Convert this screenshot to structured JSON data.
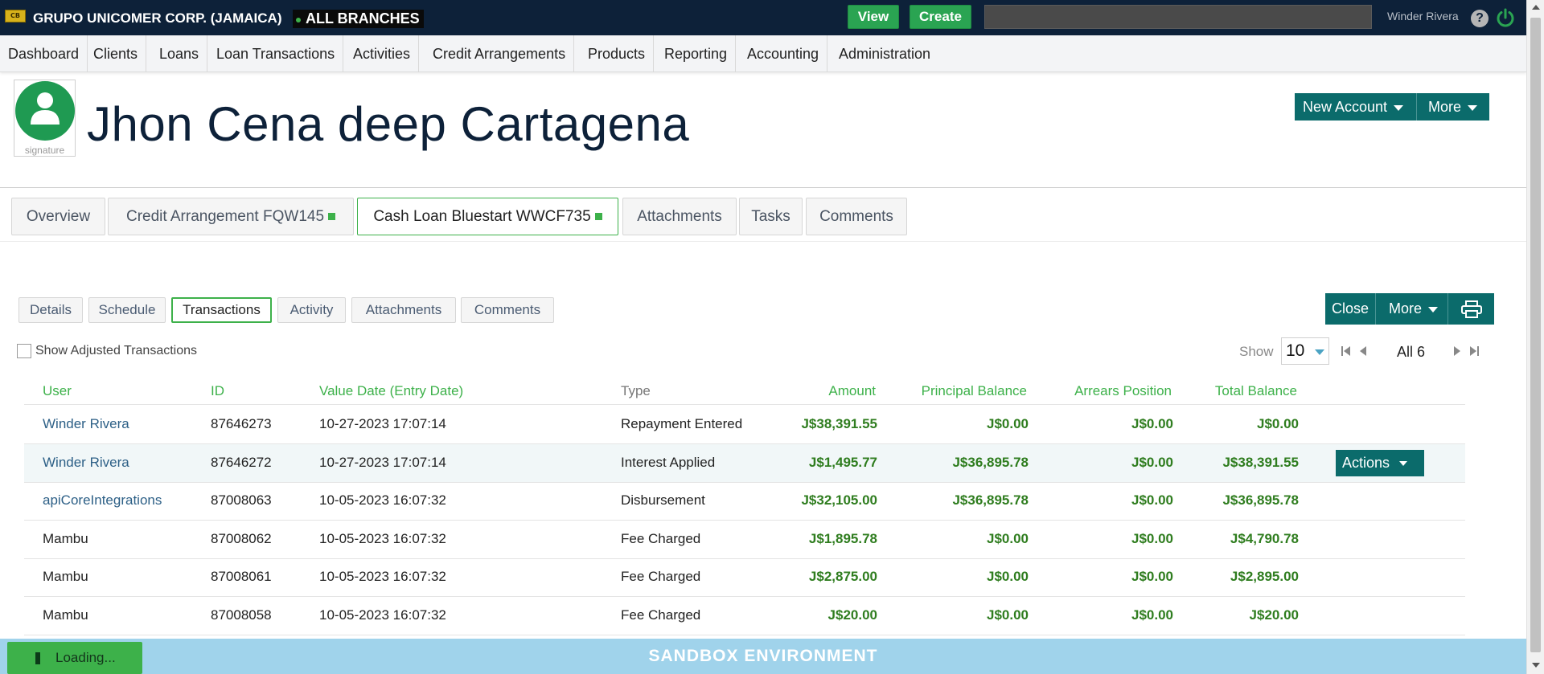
{
  "topbar": {
    "logo_text": "CB",
    "org_name": "GRUPO UNICOMER CORP. (JAMAICA)",
    "branch": "ALL BRANCHES",
    "view_label": "View",
    "create_label": "Create",
    "search_value": "",
    "user_name": "Winder Rivera",
    "help_symbol": "?",
    "colors": {
      "background": "#0d2139",
      "green": "#2aa452"
    }
  },
  "menu": {
    "items": [
      "Dashboard",
      "Clients",
      "Loans",
      "Loan  Transactions",
      "Activities",
      "Credit  Arrangements",
      "Products",
      "Reporting",
      "Accounting",
      "Administration"
    ]
  },
  "client": {
    "name": "Jhon Cena deep Cartagena",
    "avatar_caption": "signature",
    "new_account_label": "New  Account",
    "more_label": "More"
  },
  "account_tabs": [
    {
      "label": "Overview",
      "active": false,
      "has_badge": false
    },
    {
      "label": "Credit Arrangement FQW145",
      "active": false,
      "has_badge": true
    },
    {
      "label": "Cash Loan Bluestart WWCF735",
      "active": true,
      "has_badge": true
    },
    {
      "label": "Attachments",
      "active": false,
      "has_badge": false
    },
    {
      "label": "Tasks",
      "active": false,
      "has_badge": false
    },
    {
      "label": "Comments",
      "active": false,
      "has_badge": false
    }
  ],
  "sub_tabs": [
    {
      "label": "Details",
      "active": false
    },
    {
      "label": "Schedule",
      "active": false
    },
    {
      "label": "Transactions",
      "active": true
    },
    {
      "label": "Activity",
      "active": false
    },
    {
      "label": "Attachments",
      "active": false
    },
    {
      "label": "Comments",
      "active": false
    }
  ],
  "transactions_toolbar": {
    "close_label": "Close",
    "more_label": "More",
    "show_adjusted_label": "Show Adjusted Transactions",
    "show_adjusted_checked": false,
    "show_label": "Show",
    "page_size": "10",
    "pager_text": "All 6"
  },
  "table": {
    "headers": {
      "user": "User",
      "id": "ID",
      "value_date": "Value Date (Entry Date)",
      "type": "Type",
      "amount": "Amount",
      "principal_balance": "Principal Balance",
      "arrears_position": "Arrears Position",
      "total_balance": "Total Balance"
    },
    "rows": [
      {
        "user": "Winder Rivera",
        "user_link": true,
        "id": "87646273",
        "value_date": "10-27-2023 17:07:14",
        "type": "Repayment Entered",
        "amount": "J$38,391.55",
        "principal_balance": "J$0.00",
        "arrears_position": "J$0.00",
        "total_balance": "J$0.00",
        "highlight": false,
        "action": ""
      },
      {
        "user": "Winder Rivera",
        "user_link": true,
        "id": "87646272",
        "value_date": "10-27-2023 17:07:14",
        "type": "Interest Applied",
        "amount": "J$1,495.77",
        "principal_balance": "J$36,895.78",
        "arrears_position": "J$0.00",
        "total_balance": "J$38,391.55",
        "highlight": true,
        "action": "Actions"
      },
      {
        "user": "apiCoreIntegrations",
        "user_link": true,
        "id": "87008063",
        "value_date": "10-05-2023 16:07:32",
        "type": "Disbursement",
        "amount": "J$32,105.00",
        "principal_balance": "J$36,895.78",
        "arrears_position": "J$0.00",
        "total_balance": "J$36,895.78",
        "highlight": false,
        "action": ""
      },
      {
        "user": "Mambu",
        "user_link": false,
        "id": "87008062",
        "value_date": "10-05-2023 16:07:32",
        "type": "Fee Charged",
        "amount": "J$1,895.78",
        "principal_balance": "J$0.00",
        "arrears_position": "J$0.00",
        "total_balance": "J$4,790.78",
        "highlight": false,
        "action": ""
      },
      {
        "user": "Mambu",
        "user_link": false,
        "id": "87008061",
        "value_date": "10-05-2023 16:07:32",
        "type": "Fee Charged",
        "amount": "J$2,875.00",
        "principal_balance": "J$0.00",
        "arrears_position": "J$0.00",
        "total_balance": "J$2,895.00",
        "highlight": false,
        "action": ""
      },
      {
        "user": "Mambu",
        "user_link": false,
        "id": "87008058",
        "value_date": "10-05-2023 16:07:32",
        "type": "Fee Charged",
        "amount": "J$20.00",
        "principal_balance": "J$0.00",
        "arrears_position": "J$0.00",
        "total_balance": "J$20.00",
        "highlight": false,
        "action": ""
      }
    ]
  },
  "footer": {
    "sandbox_label": "SANDBOX ENVIRONMENT",
    "loading_label": "Loading..."
  }
}
